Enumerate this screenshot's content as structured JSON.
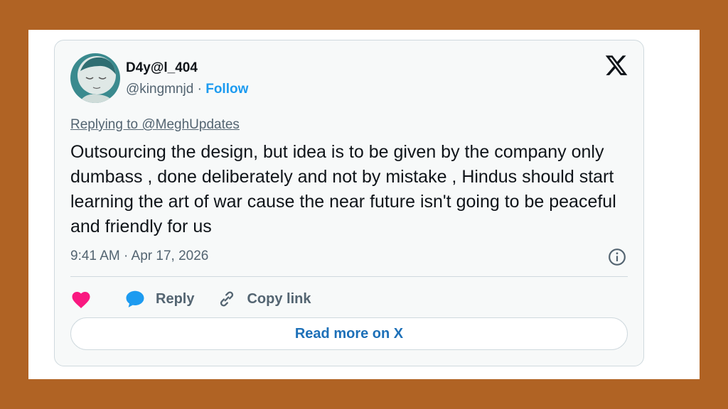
{
  "tweet": {
    "display_name": "D4y@l_404",
    "handle": "@kingmnjd",
    "separator": " · ",
    "follow_label": "Follow",
    "replying_to": "Replying to @MeghUpdates",
    "text": "Outsourcing the design, but idea is to be given by the company only dumbass , done deliberately and not by mistake , Hindus should start learning the art of war cause the near future isn't going to be peaceful and friendly for us",
    "timestamp": "9:41 AM · Apr 17, 2026"
  },
  "actions": {
    "reply_label": "Reply",
    "copy_label": "Copy link",
    "read_more_label": "Read more on X"
  },
  "icons": {
    "brand": "x-logo-icon",
    "like": "heart-icon",
    "reply": "speech-bubble-icon",
    "copy": "link-icon",
    "info": "info-icon"
  },
  "colors": {
    "frame_background": "#b06324",
    "accent_blue": "#1d9bf0",
    "heart_pink": "#f91880"
  }
}
